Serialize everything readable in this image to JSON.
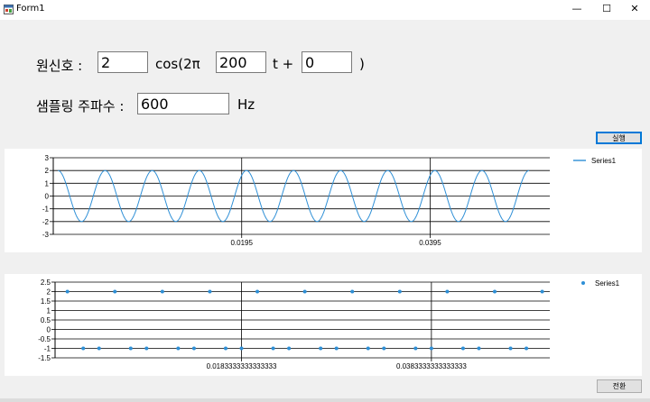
{
  "window": {
    "title": "Form1",
    "min_glyph": "—",
    "max_glyph": "☐",
    "close_glyph": "✕"
  },
  "form": {
    "signal_label": "원신호 :",
    "amplitude": "2",
    "cos_label": "cos(2π",
    "frequency": "200",
    "t_label": "t +",
    "phase": "0",
    "close_paren": ")",
    "sampling_label": "샘플링 주파수 :",
    "sampling_freq": "600",
    "hz_label": "Hz",
    "run_button": "실행",
    "bottom_button": "전환"
  },
  "chart_data": [
    {
      "type": "line",
      "ylim": [
        -3,
        3
      ],
      "yticks": [
        "3",
        "2",
        "1",
        "0",
        "-1",
        "-2",
        "-3"
      ],
      "xticks": [
        "0.0195",
        "0.0395"
      ],
      "x_range": [
        -0.0005,
        0.0522
      ],
      "tick_x": [
        0.0195,
        0.0395
      ],
      "series": [
        {
          "name": "Series1",
          "color": "#2e8fd6",
          "amplitude": 2,
          "frequency": 200,
          "phase": 0,
          "x_start": 0,
          "x_end": 0.05
        }
      ],
      "legend": "top-right",
      "grid": true
    },
    {
      "type": "scatter",
      "ylim": [
        -1.5,
        2.5
      ],
      "yticks": [
        "2.5",
        "2",
        "1.5",
        "1",
        "0.5",
        "0",
        "-0.5",
        "-1",
        "-1.5"
      ],
      "xticks": [
        "0.0183333333333333",
        "0.0383333333333333"
      ],
      "x_range": [
        -0.0013,
        0.0508
      ],
      "tick_x": [
        0.0183333,
        0.0383333
      ],
      "series": [
        {
          "name": "Series1",
          "color": "#2e8fd6",
          "x": [
            0,
            0.0016667,
            0.0033333,
            0.005,
            0.0066667,
            0.0083333,
            0.01,
            0.0116667,
            0.0133333,
            0.015,
            0.0166667,
            0.0183333,
            0.02,
            0.0216667,
            0.0233333,
            0.025,
            0.0266667,
            0.0283333,
            0.03,
            0.0316667,
            0.0333333,
            0.035,
            0.0366667,
            0.0383333,
            0.04,
            0.0416667,
            0.0433333,
            0.045,
            0.0466667,
            0.0483333,
            0.05
          ],
          "y": [
            2,
            -1,
            -1,
            2,
            -1,
            -1,
            2,
            -1,
            -1,
            2,
            -1,
            -1,
            2,
            -1,
            -1,
            2,
            -1,
            -1,
            2,
            -1,
            -1,
            2,
            -1,
            -1,
            2,
            -1,
            -1,
            2,
            -1,
            -1,
            2
          ]
        }
      ],
      "legend": "top-right",
      "grid": true
    }
  ]
}
